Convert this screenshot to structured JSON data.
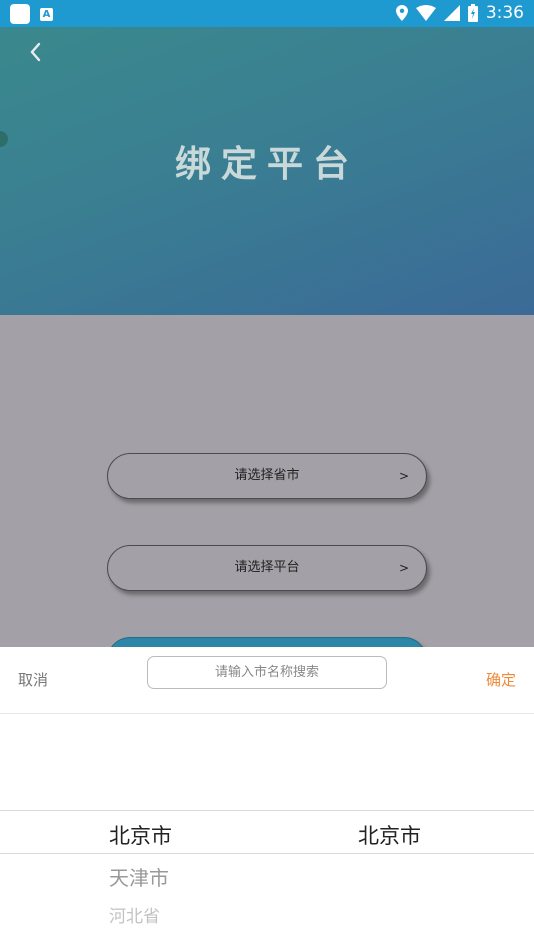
{
  "status_bar": {
    "time": "3:36"
  },
  "header": {
    "title": "绑定平台"
  },
  "form": {
    "province_placeholder": "请选择省市",
    "platform_placeholder": "请选择平台",
    "arrow": ">"
  },
  "picker": {
    "cancel": "取消",
    "confirm": "确定",
    "search_placeholder": "请输入市名称搜索",
    "left_column": [
      "北京市",
      "天津市",
      "河北省"
    ],
    "right_column": [
      "北京市"
    ]
  },
  "colors": {
    "status_bar": "#1f9ad1",
    "confirm_accent": "#f08a3a",
    "overlay": "#a3a1a7"
  }
}
